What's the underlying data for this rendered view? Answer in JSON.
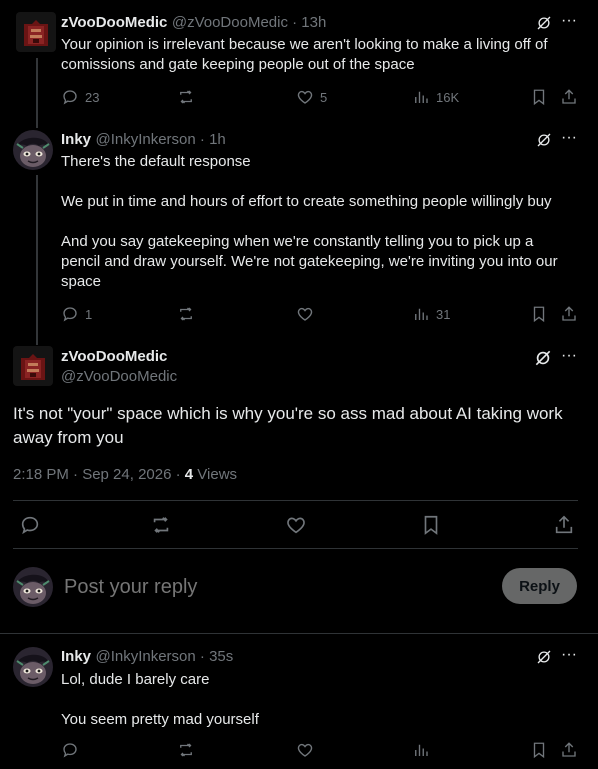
{
  "posts": [
    {
      "author": "zVooDooMedic",
      "meta": "@zVooDooMedic · 13h",
      "text": "Your opinion is irrelevant because we aren't looking to make a living off of\ncomissions and gate keeping people out of the space",
      "replies": "23",
      "reposts": "",
      "likes": "5",
      "views": "16K"
    },
    {
      "author": "Inky",
      "meta": "@InkyInkerson · 1h",
      "text": "There's the default response\n\nWe put in time and hours of effort to create something people willingly buy\n\nAnd you say gatekeeping when we're constantly telling you to pick up a\npencil and draw yourself. We're not gatekeeping, we're inviting you into our\nspace",
      "replies": "1",
      "reposts": "",
      "likes": "",
      "views": "31"
    }
  ],
  "main_post": {
    "author": "zVooDooMedic",
    "handle": "@zVooDooMedic",
    "text": "It's not \"your\" space which is why you're so ass mad about AI taking work\naway from you",
    "timestamp": "2:18 PM · Sep 24, 2026 · ",
    "views_count": "4",
    "views_label": " Views"
  },
  "composer": {
    "placeholder": "Post your reply",
    "reply_label": "Reply"
  },
  "last_reply": {
    "author": "Inky",
    "meta": "@InkyInkerson · 35s",
    "text": "Lol, dude I barely care\n\nYou seem pretty mad yourself"
  },
  "icons": {
    "more": "more-icon",
    "grok": "grok-icon",
    "reply": "reply-icon",
    "repost": "repost-icon",
    "like": "like-icon",
    "views": "views-icon",
    "bookmark": "bookmark-icon",
    "share": "share-icon"
  },
  "colors": {
    "background": "#000000",
    "text": "#e7e9ea",
    "muted": "#71767b",
    "divider": "#2f3336",
    "reply_button": "#787a7a"
  }
}
